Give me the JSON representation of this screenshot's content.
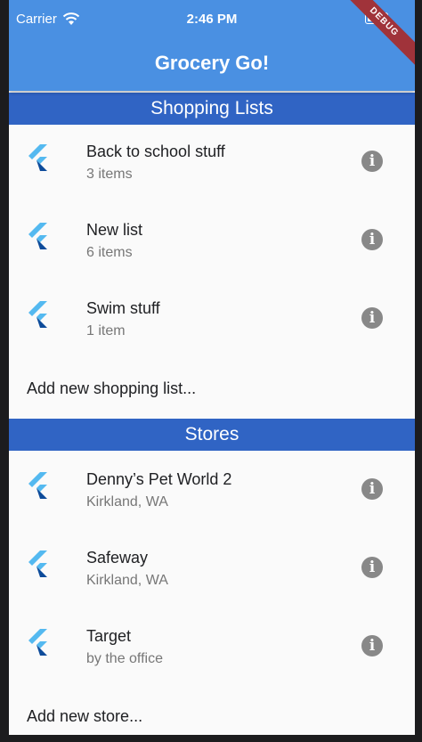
{
  "status": {
    "carrier": "Carrier",
    "time": "2:46 PM"
  },
  "appbar": {
    "title": "Grocery Go!",
    "badge": "DEBUG"
  },
  "shopping": {
    "header": "Shopping Lists",
    "items": [
      {
        "name": "Back to school stuff",
        "sub": "3 items"
      },
      {
        "name": "New list",
        "sub": "6 items"
      },
      {
        "name": "Swim stuff",
        "sub": "1 item"
      }
    ],
    "add_label": "Add new shopping list..."
  },
  "stores": {
    "header": "Stores",
    "items": [
      {
        "name": "Denny’s Pet World 2",
        "sub": "Kirkland, WA"
      },
      {
        "name": "Safeway",
        "sub": "Kirkland, WA"
      },
      {
        "name": "Target",
        "sub": "by the office"
      }
    ],
    "add_label": "Add new store..."
  },
  "icons": {
    "list_logo": "flutter-logo-icon",
    "info": "info-icon",
    "wifi": "wifi-icon",
    "battery": "battery-icon"
  },
  "colors": {
    "appbar": "#4a90e2",
    "section_header": "#3064c4",
    "debug_banner": "#a0333a"
  }
}
